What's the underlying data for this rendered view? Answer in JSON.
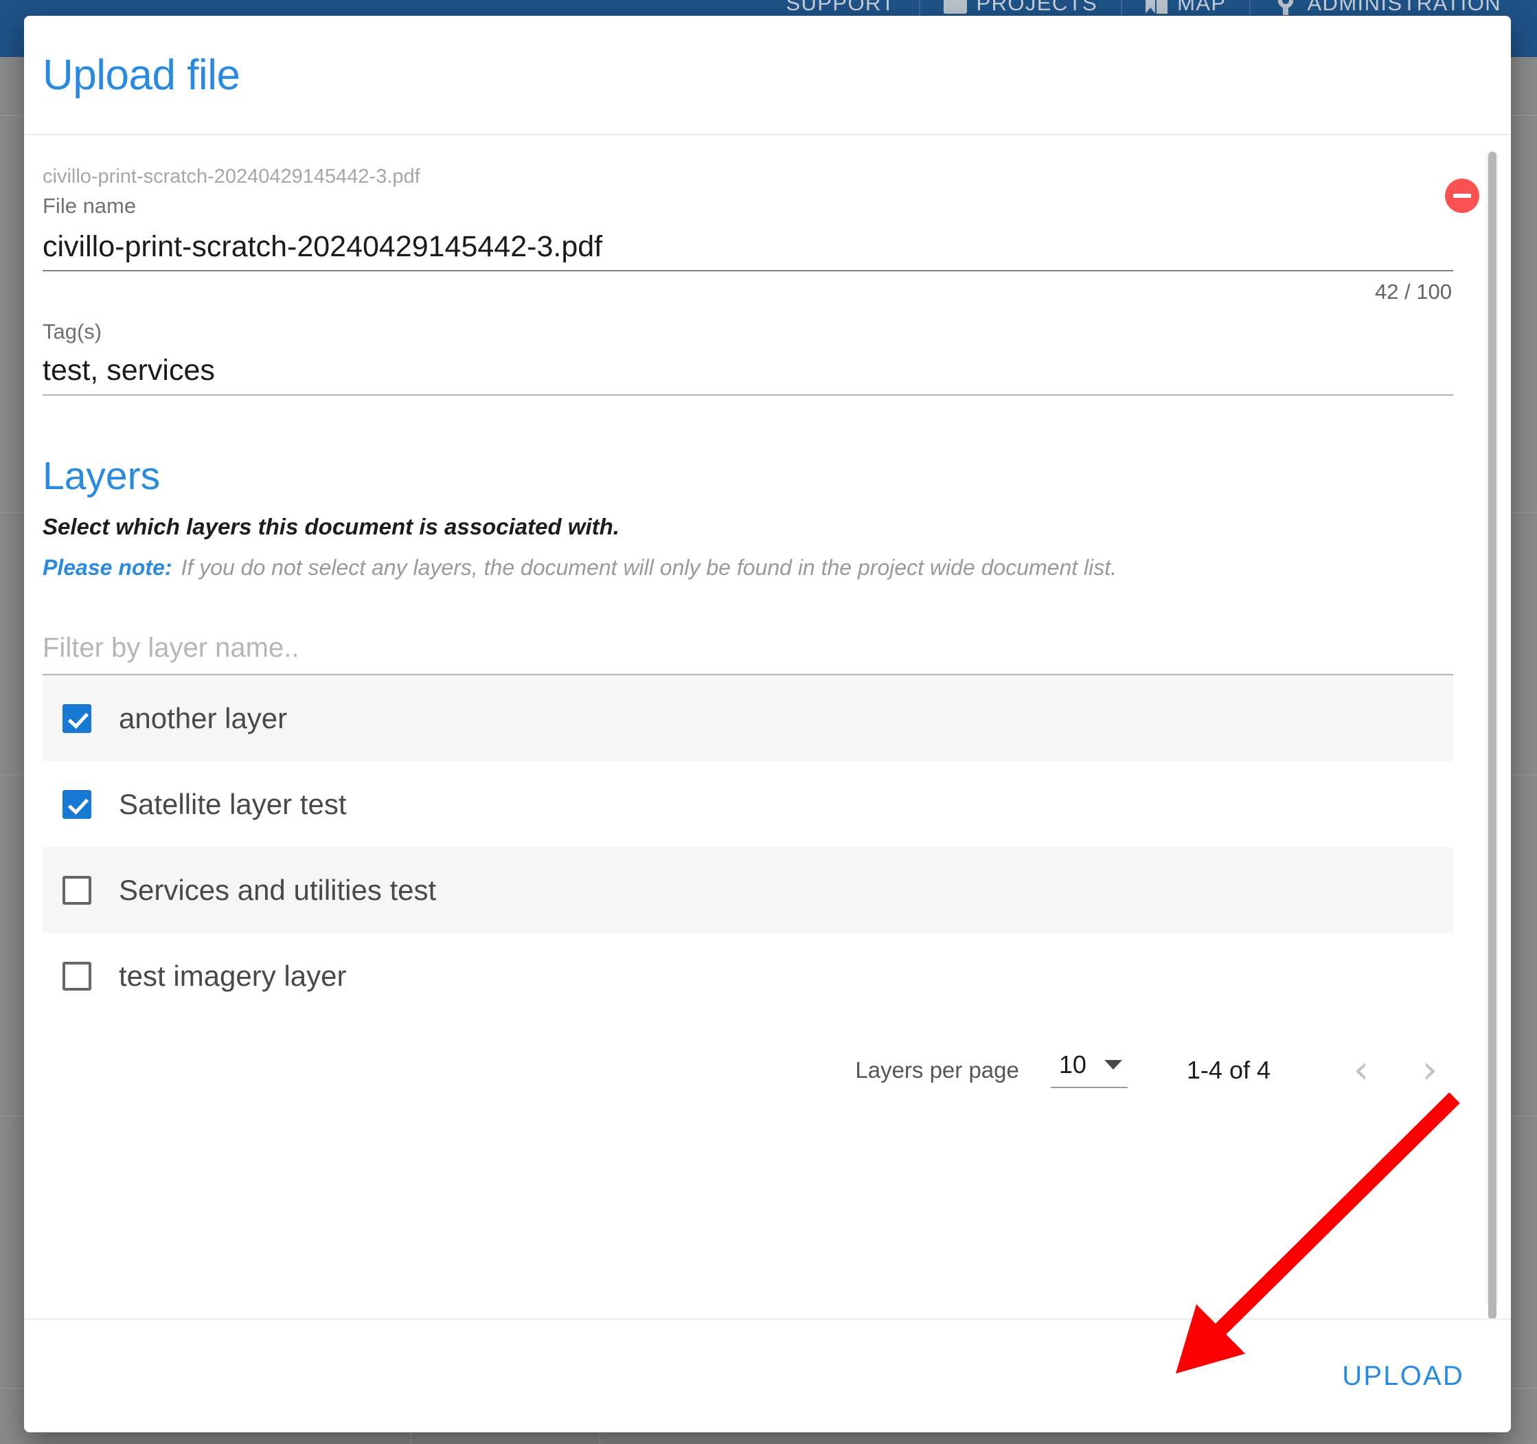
{
  "background_nav": {
    "items": [
      {
        "label": "SUPPORT",
        "icon": ""
      },
      {
        "label": "PROJECTS",
        "icon": "folder-icon"
      },
      {
        "label": "MAP",
        "icon": "map-icon"
      },
      {
        "label": "ADMINISTRATION",
        "icon": "gear-icon"
      }
    ]
  },
  "dialog": {
    "title": "Upload file",
    "file": {
      "hint": "civillo-print-scratch-20240429145442-3.pdf",
      "name_label": "File name",
      "name_value": "civillo-print-scratch-20240429145442-3.pdf",
      "char_count": "42 / 100",
      "remove_icon": "remove-circle-icon"
    },
    "tags": {
      "label": "Tag(s)",
      "value": "test, services"
    },
    "layers": {
      "title": "Layers",
      "subtitle": "Select which layers this document is associated with.",
      "note_label": "Please note:",
      "note_text": "If you do not select any layers, the document will only be found in the project wide document list.",
      "filter_placeholder": "Filter by layer name..",
      "filter_value": "",
      "items": [
        {
          "label": "another layer",
          "checked": true
        },
        {
          "label": "Satellite layer test",
          "checked": true
        },
        {
          "label": "Services and utilities test",
          "checked": false
        },
        {
          "label": "test imagery layer",
          "checked": false
        }
      ]
    },
    "paginator": {
      "items_per_page_label": "Layers per page",
      "items_per_page_value": "10",
      "range_label": "1-4 of 4",
      "prev_icon": "chevron-left-icon",
      "next_icon": "chevron-right-icon"
    },
    "footer": {
      "upload_label": "UPLOAD"
    }
  },
  "annotation": {
    "arrow_color": "#fa0000",
    "name": "red-pointer-arrow"
  },
  "colors": {
    "accent_blue": "#2a8ae0",
    "nav_blue": "#1f5287",
    "checkbox_blue": "#1878d2",
    "remove_red": "#fa5252",
    "annotation_red": "#fa0000"
  }
}
